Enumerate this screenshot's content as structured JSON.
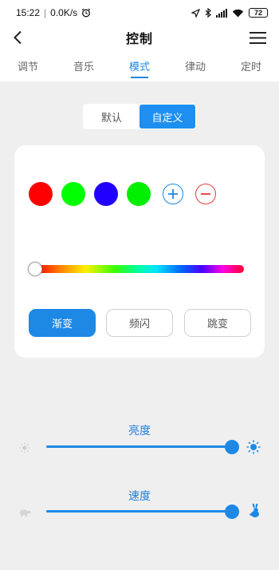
{
  "status_bar": {
    "time": "15:22",
    "separator": "|",
    "speed": "0.0K/s",
    "battery": "72"
  },
  "header": {
    "title": "控制"
  },
  "tabs": [
    {
      "label": "调节",
      "active": false
    },
    {
      "label": "音乐",
      "active": false
    },
    {
      "label": "模式",
      "active": true
    },
    {
      "label": "律动",
      "active": false
    },
    {
      "label": "定时",
      "active": false
    }
  ],
  "segment": {
    "default_label": "默认",
    "custom_label": "自定义",
    "selected": "自定义"
  },
  "colors": {
    "accent": "#1e88e5",
    "add_color": "#1e88e5",
    "remove_color": "#e53935"
  },
  "swatches": [
    "#ff0000",
    "#00ff00",
    "#2200ff",
    "#00ee00"
  ],
  "spectrum_position": 0.0,
  "modes": {
    "gradient_label": "渐变",
    "flash_label": "频闪",
    "jump_label": "跳变",
    "selected": "渐变"
  },
  "brightness": {
    "label": "亮度",
    "value": 1.0,
    "low_icon": "dim-sun-icon",
    "high_icon": "bright-sun-icon"
  },
  "speed": {
    "label": "速度",
    "value": 1.0,
    "low_icon": "turtle-icon",
    "high_icon": "rabbit-icon"
  }
}
